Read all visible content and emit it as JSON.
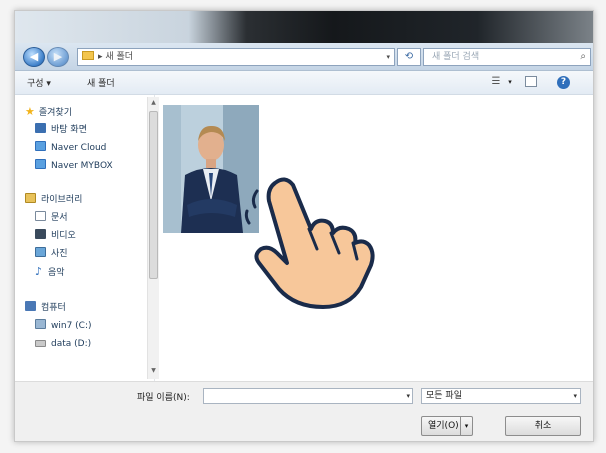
{
  "address_bar": {
    "path": "▸ 새 폴더",
    "search_placeholder": "새 폴더 검색"
  },
  "toolbar": {
    "organize_label": "구성 ▾",
    "new_folder_label": "새 폴더"
  },
  "sidebar": {
    "favorites": {
      "label": "즐겨찾기",
      "items": [
        "바탕 화면",
        "Naver Cloud",
        "Naver MYBOX"
      ]
    },
    "libraries": {
      "label": "라이브러리",
      "items": [
        "문서",
        "비디오",
        "사진",
        "음악"
      ]
    },
    "computer": {
      "label": "컴퓨터",
      "items": [
        "win7 (C:)",
        "data (D:)"
      ]
    }
  },
  "bottom": {
    "filename_label": "파일 이름(N):",
    "filename_value": "",
    "filetype_value": "모든 파일",
    "open_button": "열기(O)",
    "cancel_button": "취소"
  },
  "colors": {
    "accent": "#3d7fc9",
    "hand_fill": "#f7c79a",
    "hand_outline": "#1a2b4a"
  }
}
